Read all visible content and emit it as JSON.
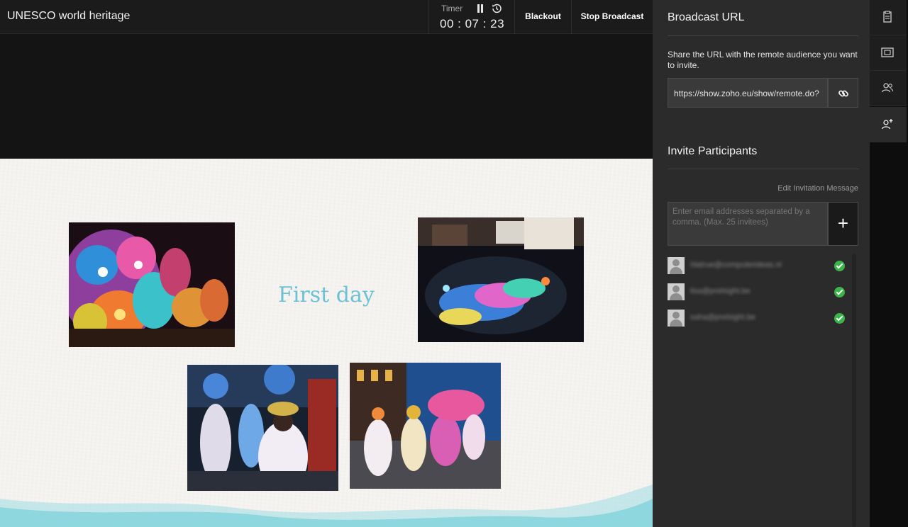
{
  "header": {
    "title": "UNESCO world heritage",
    "timer_label": "Timer",
    "timer_value": "00 : 07 : 23",
    "blackout_label": "Blackout",
    "stop_broadcast_label": "Stop Broadcast"
  },
  "slide": {
    "title": "First day"
  },
  "panel": {
    "broadcast_heading": "Broadcast URL",
    "broadcast_desc": "Share the URL with the remote audience you want to invite.",
    "broadcast_url": "https://show.zoho.eu/show/remote.do?",
    "invite_heading": "Invite Participants",
    "edit_invitation": "Edit Invitation Message",
    "email_placeholder": "Enter email addresses separated by a comma. (Max. 25 invitees)",
    "add_symbol": "+",
    "invitees": [
      {
        "email": "hlatrue@computerideas.nl",
        "status": "sent"
      },
      {
        "email": "lisa@prelsight.be",
        "status": "sent"
      },
      {
        "email": "saha@prelsight.be",
        "status": "sent"
      }
    ]
  },
  "rail": {
    "icons": [
      "notes-icon",
      "slides-icon",
      "audience-icon",
      "invite-participant-icon"
    ],
    "active": "invite-participant-icon"
  },
  "colors": {
    "accent_title": "#6cc1d6",
    "status_ok": "#3bb54a",
    "wave": "#7fd3dc"
  }
}
